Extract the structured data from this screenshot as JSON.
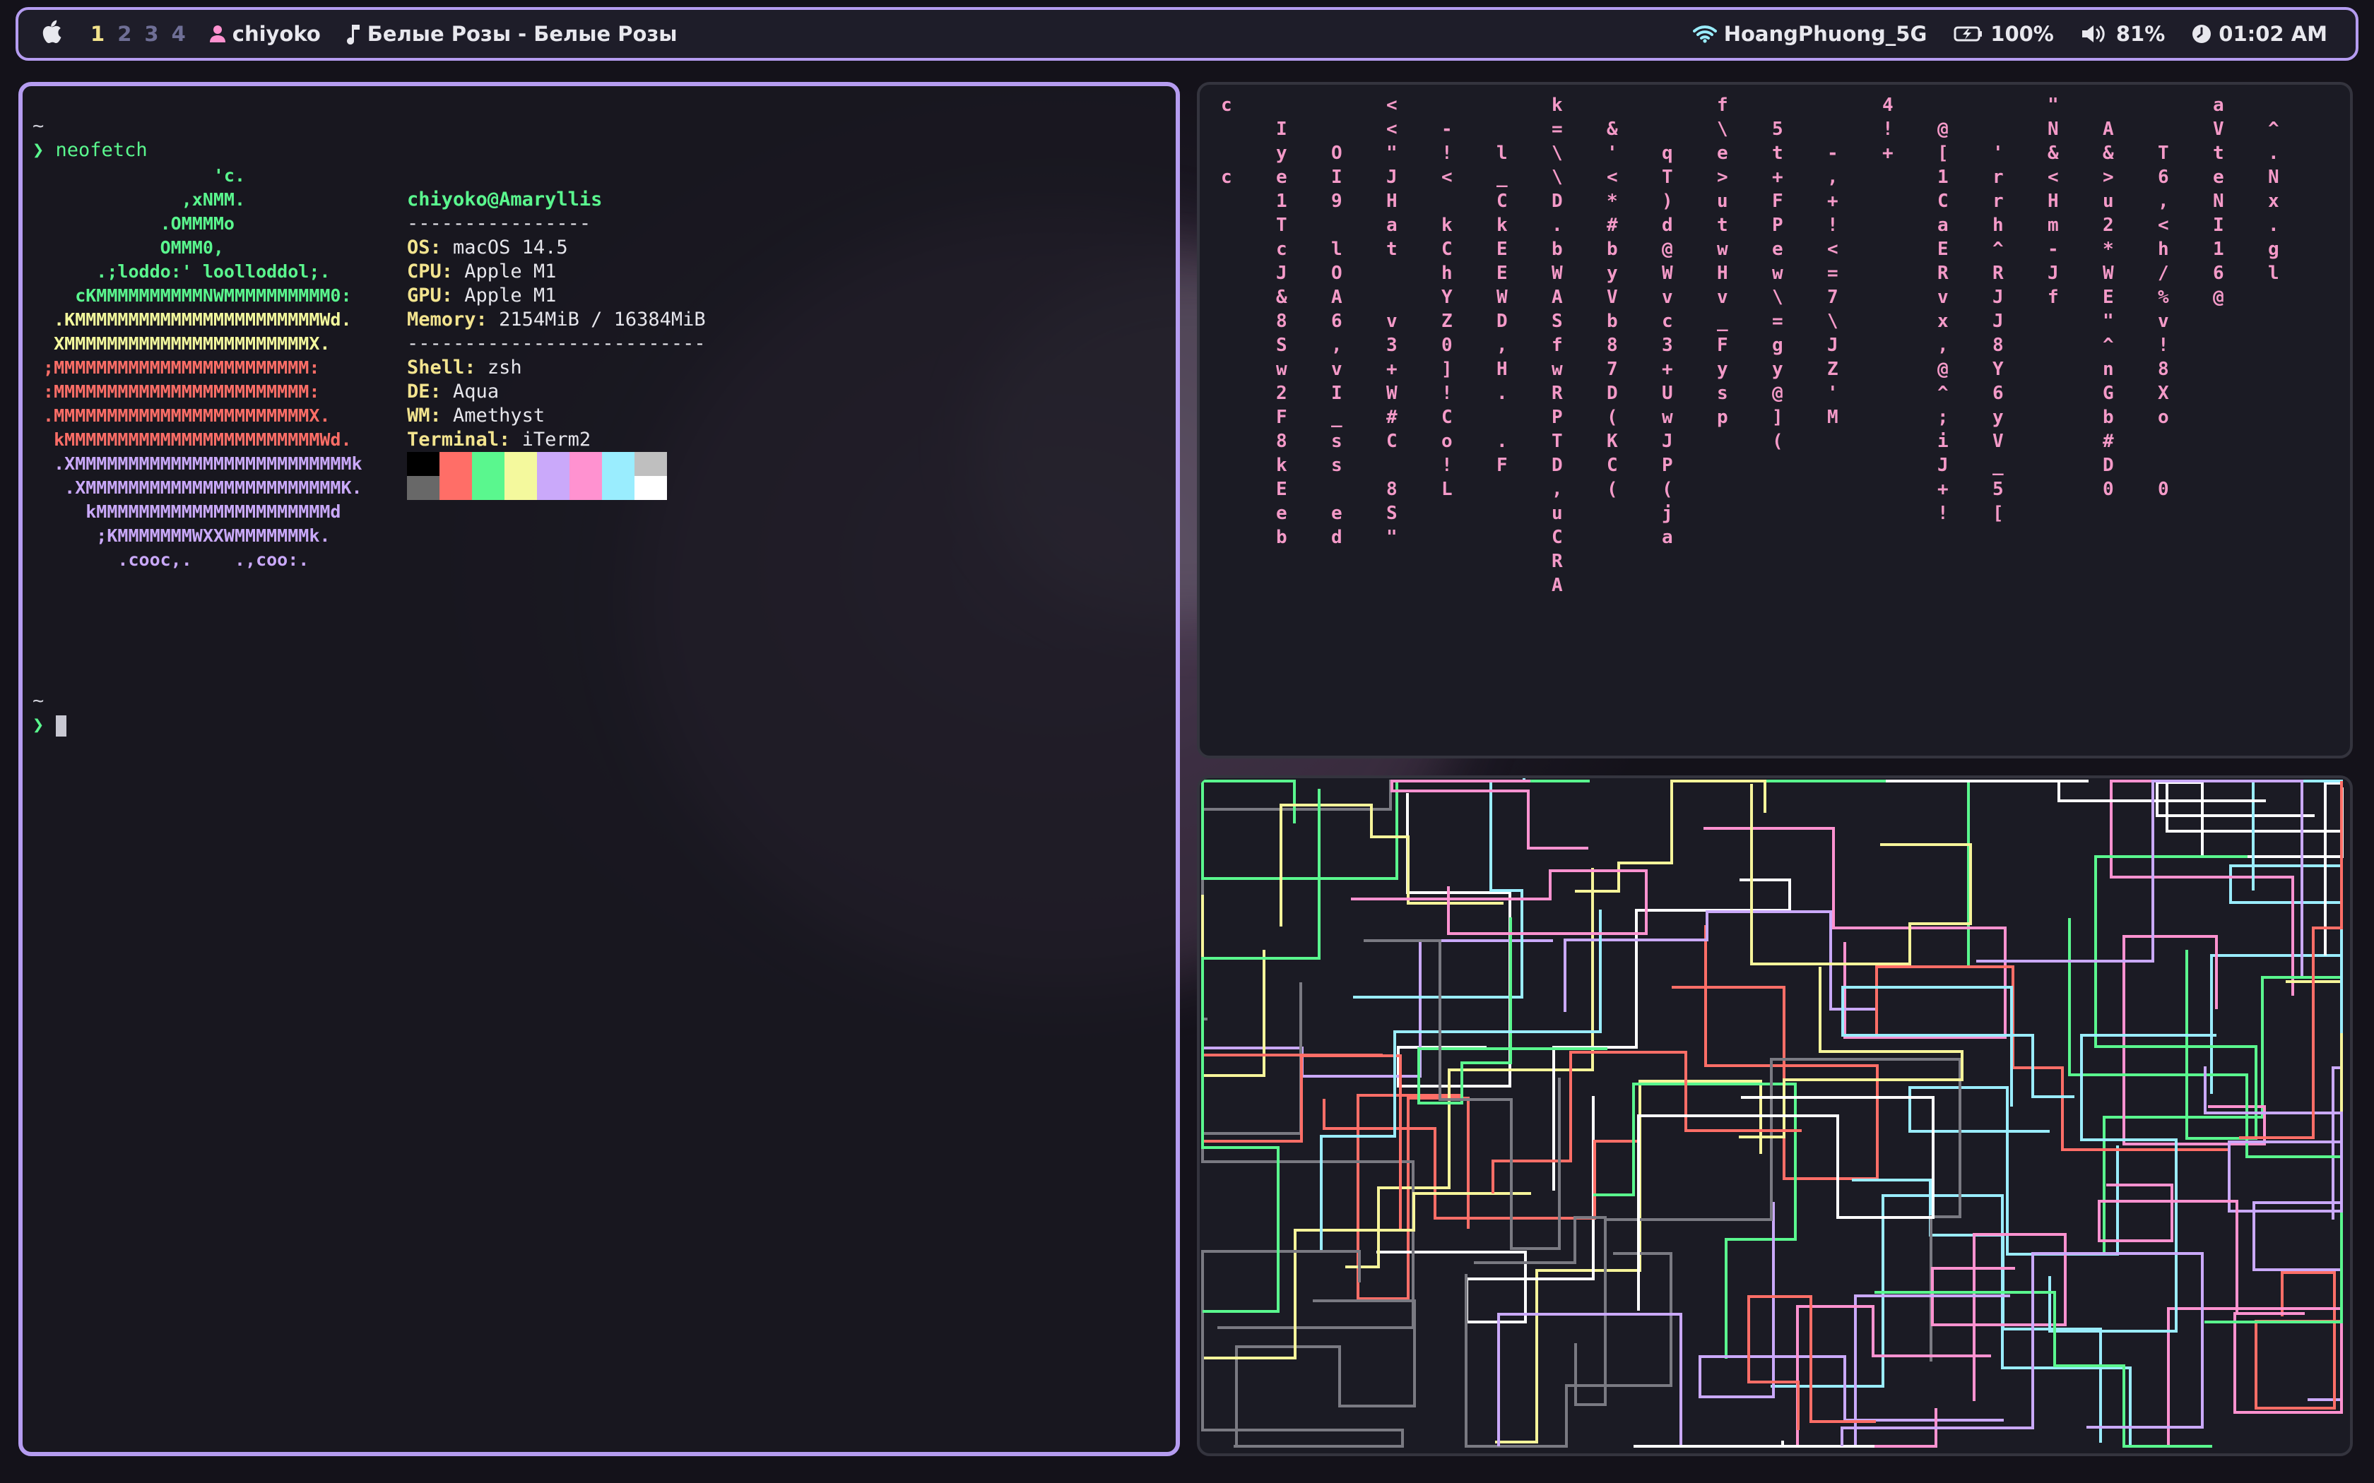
{
  "menubar": {
    "apple_icon": "apple-icon",
    "workspaces": [
      "1",
      "2",
      "3",
      "4"
    ],
    "active_workspace": "1",
    "user": "chiyoko",
    "now_playing": "Белые Розы - Белые Розы",
    "wifi": "HoangPhuong_5G",
    "battery": "100%",
    "volume": "81%",
    "clock": "01:02 AM"
  },
  "terminal": {
    "prompt_dir": "~",
    "prompt_symbol": "❯",
    "command": "neofetch",
    "logo_lines": [
      "                 'c.",
      "              ,xNMM.",
      "            .OMMMMo",
      "            OMMM0,",
      "      .;loddo:' loolloddol;.",
      "    cKMMMMMMMMMMNWMMMMMMMMMM0:",
      "  .KMMMMMMMMMMMMMMMMMMMMMMMWd.",
      "  XMMMMMMMMMMMMMMMMMMMMMMMX.",
      " ;MMMMMMMMMMMMMMMMMMMMMMMM:",
      " :MMMMMMMMMMMMMMMMMMMMMMMM:",
      " .MMMMMMMMMMMMMMMMMMMMMMMMX.",
      "  kMMMMMMMMMMMMMMMMMMMMMMMMWd.",
      "  .XMMMMMMMMMMMMMMMMMMMMMMMMMMk",
      "   .XMMMMMMMMMMMMMMMMMMMMMMMMK.",
      "     kMMMMMMMMMMMMMMMMMMMMMMd",
      "      ;KMMMMMMMWXXWMMMMMMMk.",
      "        .cooc,.    .,coo:."
    ],
    "user": "chiyoko",
    "host": "Amaryllis",
    "separator1": "----------------",
    "os_label": "OS:",
    "os": "macOS 14.5",
    "cpu_label": "CPU:",
    "cpu": "Apple M1",
    "gpu_label": "GPU:",
    "gpu": "Apple M1",
    "memory_label": "Memory:",
    "memory": "2154MiB / 16384MiB",
    "separator2": "--------------------------",
    "shell_label": "Shell:",
    "shell": "zsh",
    "de_label": "DE:",
    "de": "Aqua",
    "wm_label": "WM:",
    "wm": "Amethyst",
    "terminal_label": "Terminal:",
    "terminal_app": "iTerm2",
    "palette_top": [
      "#000000",
      "#ff6e67",
      "#5af78e",
      "#f4f99d",
      "#caa9fa",
      "#ff92d0",
      "#9aedfe",
      "#bfbfbf"
    ],
    "palette_bottom": [
      "#686868",
      "#ff6e67",
      "#5af78e",
      "#f4f99d",
      "#caa9fa",
      "#ff92d0",
      "#9aedfe",
      "#ffffff"
    ]
  },
  "matrix": {
    "columns": [
      "c\n\n\nc",
      "I\ny\ne\n1\nT\nc\nJ\n&\n8\nS\nw\n2\nF\n8\nk\nE\ne\nb",
      "O\nI\n9\n\nl\nO\nA\n6\n,\nv\nI\n_\ns\ns\n\ne\nd",
      "<\n<\n\"\nJ\nH\na\nt\n\n\nv\n3\n+\nW\n#\nC\n\n8\nS\n\"",
      "-\n!\n<\n\nk\nC\nh\nY\nZ\n0\n]\n!\nC\no\n!\nL",
      "l\n_\nC\nk\nE\nE\nW\nD\n,\nH\n.\n\n.\nF",
      "k\n=\n\\\n\\\nD\n.\nb\nW\nA\nS\nf\nw\nR\nP\nT\nD\n,\nu\nC\nR\nA",
      "&\n'\n<\n*\n#\nb\ny\nV\nb\n8\n7\nD\n(\nK\nC\n(",
      "q\nT\n)\nd\n@\nW\nv\nc\n3\n+\nU\nw\nJ\nP\n(\nj\na",
      "f\n\\\ne\n>\nu\nt\nw\nH\nv\n_\nF\ny\ns\np",
      "5\nt\n+\nF\nP\ne\nw\n\\\n=\ng\ny\n@\n]\n(",
      "-\n,\n+\n!\n<\n=\n7\n\\\nJ\nZ\n'\nM",
      "4\n!\n+",
      "@\n[\n1\nC\na\nE\nR\nv\nx\n,\n@\n^\n;\ni\nJ\n+\n!",
      "'\nr\nr\nh\n^\nR\nJ\nJ\n8\nY\n6\ny\nV\n_\n5\n[",
      "\"\nN\n&\n<\nH\nm\n-\nJ\nf",
      "A\n&\n>\nu\n2\n*\nW\nE\n\"\n^\nn\nG\nb\n#\nD\n0",
      "T\n6\n,\n<\nh\n/\n%\nv\n!\n8\nX\no\n\n\n0",
      "a\nV\nt\ne\nN\nI\n1\n6\n@",
      "^\n.\nN\nx\n.\ng\nl"
    ]
  },
  "pipes": {
    "colors": [
      "#f6f49a",
      "#ff6e67",
      "#5af78e",
      "#9aedfe",
      "#ff92d0",
      "#caa9fa",
      "#7a7a82",
      "#ffffff"
    ]
  }
}
